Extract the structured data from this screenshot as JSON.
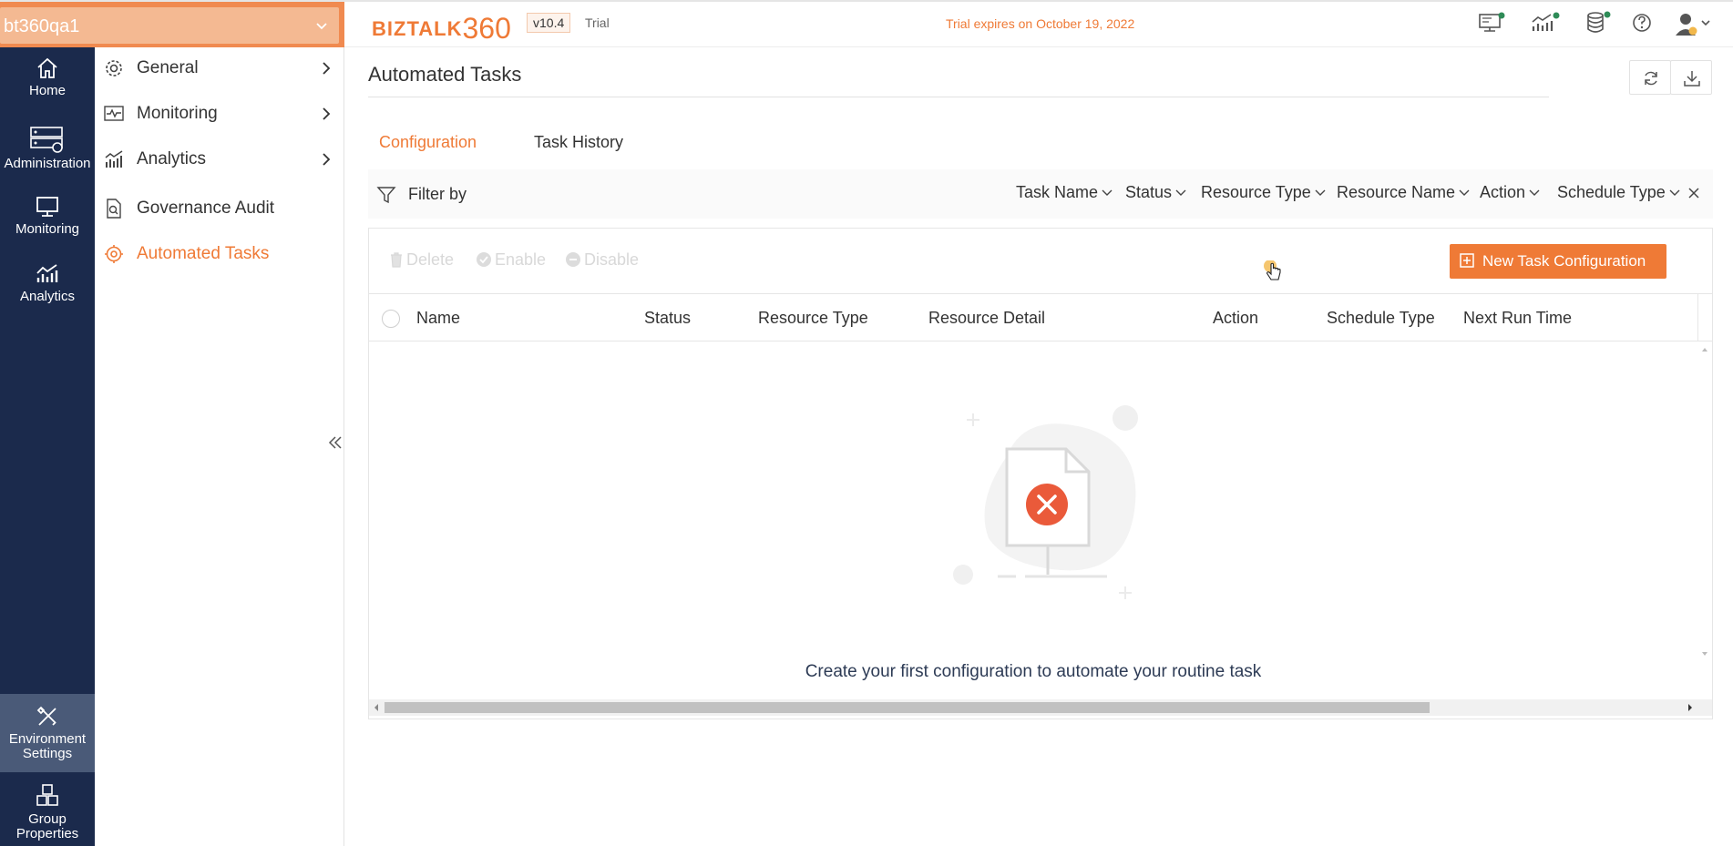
{
  "environment": {
    "name": "bt360qa1"
  },
  "header": {
    "logo_main": "BIZTALK",
    "logo_num": "360",
    "version": "v10.4",
    "trial": "Trial",
    "expires": "Trial expires on October 19, 2022"
  },
  "rail": {
    "items": [
      {
        "label": "Home",
        "icon": "home-icon"
      },
      {
        "label": "Administration",
        "icon": "administration-icon"
      },
      {
        "label": "Monitoring",
        "icon": "monitor-icon"
      },
      {
        "label": "Analytics",
        "icon": "analytics-icon"
      },
      {
        "label_line1": "Environment",
        "label_line2": "Settings",
        "icon": "tools-icon"
      },
      {
        "label_line1": "Group",
        "label_line2": "Properties",
        "icon": "group-cubes-icon"
      }
    ]
  },
  "subnav": {
    "items": [
      {
        "label": "General",
        "icon": "gear-icon"
      },
      {
        "label": "Monitoring",
        "icon": "pulse-icon"
      },
      {
        "label": "Analytics",
        "icon": "analytics-icon"
      },
      {
        "label": "Governance Audit",
        "icon": "audit-document-icon"
      },
      {
        "label": "Automated Tasks",
        "icon": "automation-icon"
      }
    ]
  },
  "page": {
    "title": "Automated Tasks"
  },
  "tabs": [
    {
      "label": "Configuration"
    },
    {
      "label": "Task History"
    }
  ],
  "filter": {
    "label": "Filter by",
    "dropdowns": [
      "Task Name",
      "Status",
      "Resource Type",
      "Resource Name",
      "Action",
      "Schedule Type"
    ]
  },
  "actions": {
    "delete": "Delete",
    "enable": "Enable",
    "disable": "Disable",
    "new_task": "New Task Configuration"
  },
  "table": {
    "columns": [
      "Name",
      "Status",
      "Resource Type",
      "Resource Detail",
      "Action",
      "Schedule Type",
      "Next Run Time"
    ]
  },
  "empty_state": {
    "message": "Create your first configuration to automate your routine task"
  },
  "colors": {
    "accent": "#ef7a36",
    "rail": "#1b2a4c"
  }
}
